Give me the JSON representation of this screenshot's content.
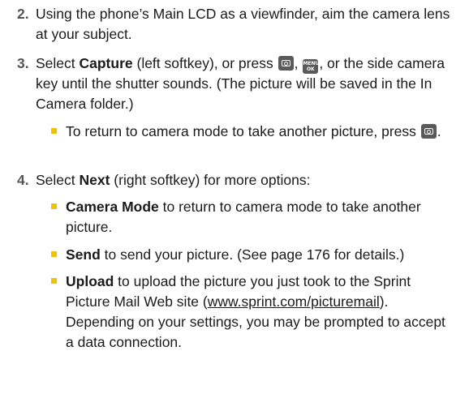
{
  "steps": [
    {
      "number": "2.",
      "text": "Using the phone’s Main LCD as a viewfinder, aim the camera lens at your subject."
    },
    {
      "number": "3.",
      "text_a": "Select ",
      "bold_a": "Capture",
      "text_b": " (left softkey), or press ",
      "text_c": ", ",
      "text_d": ", or the side camera key until the shutter sounds. (The picture will be saved in the In Camera folder.)",
      "bullets": [
        {
          "text_a": "To return to camera mode to take another picture, press ",
          "text_b": "."
        }
      ]
    },
    {
      "number": "4.",
      "text_a": "Select ",
      "bold_a": "Next",
      "text_b": " (right softkey) for more options:",
      "bullets": [
        {
          "bold": "Camera Mode",
          "text": " to return to camera mode to take another picture."
        },
        {
          "bold": "Send",
          "text": " to send your picture. (See page 176 for details.)"
        },
        {
          "bold": "Upload",
          "text_a": " to upload the picture you just took to the Sprint Picture Mail Web site (",
          "link": "www.sprint.com/picturemail",
          "text_b": "). Depending on your settings, you may be prompted to accept a data connection."
        }
      ]
    }
  ],
  "keys": {
    "camera_icon": "camera-key-icon",
    "menu_icon": "menu-ok-key-icon",
    "menu_line1": "MENU",
    "menu_line2": "OK"
  },
  "colors": {
    "bullet": "#f2c200",
    "step_number": "#555555",
    "key_background": "#5a5a5a"
  }
}
